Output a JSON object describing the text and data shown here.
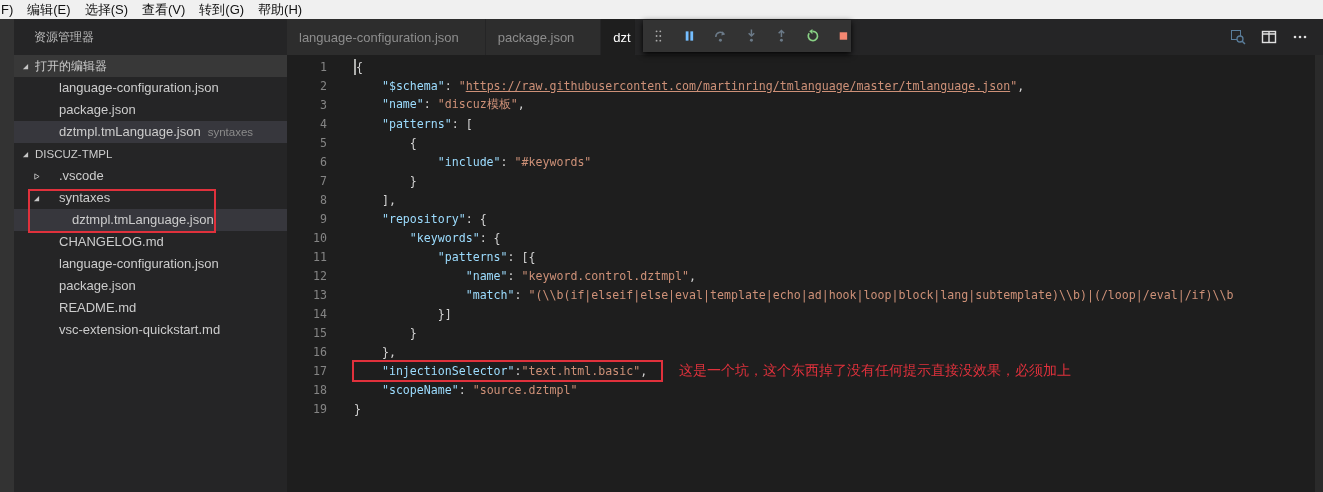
{
  "menu": [
    "F)",
    "编辑(E)",
    "选择(S)",
    "查看(V)",
    "转到(G)",
    "帮助(H)"
  ],
  "sidebar": {
    "title": "资源管理器",
    "open_editors": {
      "label": "打开的编辑器",
      "expanded": true,
      "items": [
        {
          "label": "language-configuration.json",
          "selected": false
        },
        {
          "label": "package.json",
          "selected": false
        },
        {
          "label": "dztmpl.tmLanguage.json",
          "description": "syntaxes",
          "selected": true
        }
      ]
    },
    "project": {
      "label": "DISCUZ-TMPL",
      "expanded": true,
      "tree": [
        {
          "label": ".vscode",
          "kind": "folder",
          "expanded": false,
          "highlighted": false,
          "selected": false
        },
        {
          "label": "syntaxes",
          "kind": "folder",
          "expanded": true,
          "highlighted": true,
          "selected": false,
          "children": [
            {
              "label": "dztmpl.tmLanguage.json",
              "selected": true
            }
          ]
        },
        {
          "label": "CHANGELOG.md",
          "kind": "file",
          "highlighted": false,
          "selected": false
        },
        {
          "label": "language-configuration.json",
          "kind": "file",
          "highlighted": false,
          "selected": false
        },
        {
          "label": "package.json",
          "kind": "file",
          "highlighted": false,
          "selected": false
        },
        {
          "label": "README.md",
          "kind": "file",
          "highlighted": false,
          "selected": false
        },
        {
          "label": "vsc-extension-quickstart.md",
          "kind": "file",
          "highlighted": false,
          "selected": false
        }
      ]
    }
  },
  "tabs": [
    {
      "label": "language-configuration.json",
      "selected": false
    },
    {
      "label": "package.json",
      "selected": false
    },
    {
      "label": "dzt",
      "selected": true
    }
  ],
  "editor": {
    "lines": [
      {
        "number": "1",
        "cursor": true,
        "highlighted": false,
        "tokens": [
          {
            "kind": "punct",
            "text": "{"
          }
        ]
      },
      {
        "number": "2",
        "cursor": false,
        "highlighted": false,
        "tokens": [
          {
            "kind": "key",
            "text": "    \"$schema\""
          },
          {
            "kind": "punct",
            "text": ": "
          },
          {
            "kind": "string",
            "text": "\""
          },
          {
            "kind": "link",
            "text": "https://raw.githubusercontent.com/martinring/tmlanguage/master/tmlanguage.json"
          },
          {
            "kind": "string",
            "text": "\""
          },
          {
            "kind": "punct",
            "text": ","
          }
        ]
      },
      {
        "number": "3",
        "cursor": false,
        "highlighted": false,
        "tokens": [
          {
            "kind": "key",
            "text": "    \"name\""
          },
          {
            "kind": "punct",
            "text": ": "
          },
          {
            "kind": "string",
            "text": "\"discuz模板\""
          },
          {
            "kind": "punct",
            "text": ","
          }
        ]
      },
      {
        "number": "4",
        "cursor": false,
        "highlighted": false,
        "tokens": [
          {
            "kind": "key",
            "text": "    \"patterns\""
          },
          {
            "kind": "punct",
            "text": ": ["
          }
        ]
      },
      {
        "number": "5",
        "cursor": false,
        "highlighted": false,
        "tokens": [
          {
            "kind": "punct",
            "text": "        {"
          }
        ]
      },
      {
        "number": "6",
        "cursor": false,
        "highlighted": false,
        "tokens": [
          {
            "kind": "key",
            "text": "            \"include\""
          },
          {
            "kind": "punct",
            "text": ": "
          },
          {
            "kind": "string",
            "text": "\"#keywords\""
          }
        ]
      },
      {
        "number": "7",
        "cursor": false,
        "highlighted": false,
        "tokens": [
          {
            "kind": "punct",
            "text": "        }"
          }
        ]
      },
      {
        "number": "8",
        "cursor": false,
        "highlighted": false,
        "tokens": [
          {
            "kind": "punct",
            "text": "    ],"
          }
        ]
      },
      {
        "number": "9",
        "cursor": false,
        "highlighted": false,
        "tokens": [
          {
            "kind": "key",
            "text": "    \"repository\""
          },
          {
            "kind": "punct",
            "text": ": {"
          }
        ]
      },
      {
        "number": "10",
        "cursor": false,
        "highlighted": false,
        "tokens": [
          {
            "kind": "key",
            "text": "        \"keywords\""
          },
          {
            "kind": "punct",
            "text": ": {"
          }
        ]
      },
      {
        "number": "11",
        "cursor": false,
        "highlighted": false,
        "tokens": [
          {
            "kind": "key",
            "text": "            \"patterns\""
          },
          {
            "kind": "punct",
            "text": ": [{"
          }
        ]
      },
      {
        "number": "12",
        "cursor": false,
        "highlighted": false,
        "tokens": [
          {
            "kind": "key",
            "text": "                \"name\""
          },
          {
            "kind": "punct",
            "text": ": "
          },
          {
            "kind": "string",
            "text": "\"keyword.control.dztmpl\""
          },
          {
            "kind": "punct",
            "text": ","
          }
        ]
      },
      {
        "number": "13",
        "cursor": false,
        "highlighted": false,
        "tokens": [
          {
            "kind": "key",
            "text": "                \"match\""
          },
          {
            "kind": "punct",
            "text": ": "
          },
          {
            "kind": "string",
            "text": "\"(\\\\b(if|elseif|else|eval|template|echo|ad|hook|loop|block|lang|subtemplate)\\\\b)|(/loop|/eval|/if)\\\\b"
          }
        ]
      },
      {
        "number": "14",
        "cursor": false,
        "highlighted": false,
        "tokens": [
          {
            "kind": "punct",
            "text": "            }]"
          }
        ]
      },
      {
        "number": "15",
        "cursor": false,
        "highlighted": false,
        "tokens": [
          {
            "kind": "punct",
            "text": "        }"
          }
        ]
      },
      {
        "number": "16",
        "cursor": false,
        "highlighted": false,
        "tokens": [
          {
            "kind": "punct",
            "text": "    },"
          }
        ]
      },
      {
        "number": "17",
        "cursor": false,
        "highlighted": true,
        "note": "这是一个坑，这个东西掉了没有任何提示直接没效果，必须加上",
        "tokens": [
          {
            "kind": "key",
            "text": "    \"injectionSelector\""
          },
          {
            "kind": "punct",
            "text": ":"
          },
          {
            "kind": "string",
            "text": "\"text.html.basic\""
          },
          {
            "kind": "punct",
            "text": ","
          }
        ]
      },
      {
        "number": "18",
        "cursor": false,
        "highlighted": false,
        "tokens": [
          {
            "kind": "key",
            "text": "    \"scopeName\""
          },
          {
            "kind": "punct",
            "text": ": "
          },
          {
            "kind": "string",
            "text": "\"source.dztmpl\""
          }
        ]
      },
      {
        "number": "19",
        "cursor": false,
        "highlighted": false,
        "tokens": [
          {
            "kind": "punct",
            "text": "}"
          }
        ]
      }
    ]
  }
}
